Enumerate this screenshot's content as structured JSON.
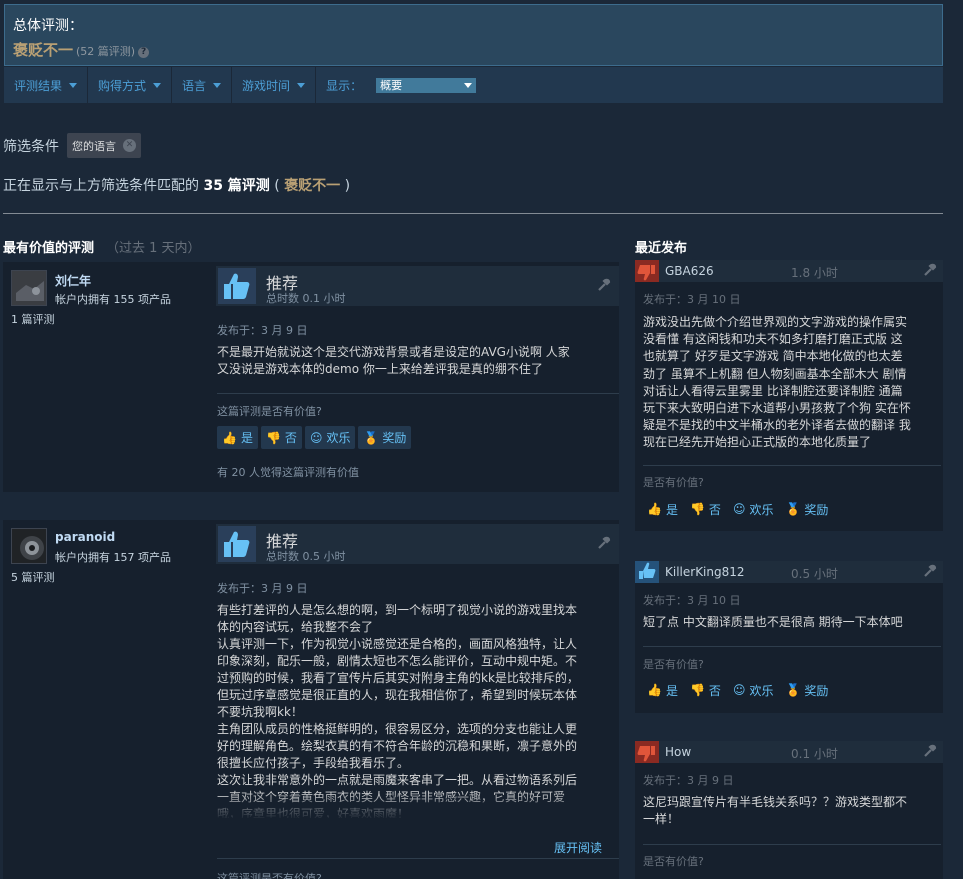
{
  "summary": {
    "label": "总体评测：",
    "rating": "褒贬不一",
    "count": "(52 篇评测)",
    "help_icon": "?"
  },
  "filterbar": {
    "items": [
      "评测结果",
      "购得方式",
      "语言",
      "游戏时间"
    ],
    "show_label": "显示：",
    "show_value": "概要"
  },
  "filters": {
    "label": "筛选条件",
    "chip": "您的语言",
    "chip_close": "✕"
  },
  "showing": {
    "prefix": "正在显示与上方筛选条件匹配的",
    "count": "35 篇评测",
    "paren_open": "(",
    "rating": "褒贬不一",
    "paren_close": ")"
  },
  "columns": {
    "helpful_title": "最有价值的评测",
    "helpful_sub": "（过去 1 天内）",
    "recent_title": "最近发布"
  },
  "colors": {
    "background": "#1b2838",
    "accent": "#66c0f4",
    "mixed": "#b9a074",
    "thumbs_up": "#67c1f5",
    "thumbs_down": "#a34c25"
  },
  "reviews": [
    {
      "author": "刘仁年",
      "products": "帐户内拥有 155 项产品",
      "reviews": "1 篇评测",
      "recommendation": "推荐",
      "hours": "总时数 0.1 小时",
      "posted": "发布于：3 月 9 日",
      "text": "不是最开始就说这个是交代游戏背景或者是设定的AVG小说啊 人家\n又没说是游戏本体的demo 你一上来给差评我是真的绷不住了",
      "helpful_q": "这篇评测是否有价值?",
      "yes": "是",
      "no": "否",
      "funny": "欢乐",
      "award": "奖励",
      "helpful_count": "有 20 人觉得这篇评测有价值"
    },
    {
      "author": "paranoid",
      "products": "帐户内拥有 157 项产品",
      "reviews": "5 篇评测",
      "recommendation": "推荐",
      "hours": "总时数 0.5 小时",
      "posted": "发布于：3 月 9 日",
      "text": "有些打差评的人是怎么想的啊，到一个标明了视觉小说的游戏里找本\n体的内容试玩，给我整不会了\n认真评测一下，作为视觉小说感觉还是合格的，画面风格独特，让人\n印象深刻，配乐一般，剧情太短也不怎么能评价，互动中规中矩。不\n过预购的时候，我看了宣传片后其实对附身主角的kk是比较排斥的，\n但玩过序章感觉是很正直的人，现在我相信你了，希望到时候玩本体\n不要坑我啊kk！\n主角团队成员的性格挺鲜明的，很容易区分，选项的分支也能让人更\n好的理解角色。绘梨衣真的有不符合年龄的沉稳和果断，凛子意外的\n很擅长应付孩子，手段给我看乐了。\n这次让我非常意外的一点就是雨魔来客串了一把。从看过物语系列后\n一直对这个穿着黄色雨衣的类人型怪异非常感兴趣，它真的好可爱\n哦，序章里也很可爱，好喜欢雨魔！",
      "read_more": "展开阅读",
      "helpful_q": "这篇评测是否有价值?"
    }
  ],
  "recent": [
    {
      "author": "GBA626",
      "hours": "1.8 小时",
      "type": "down",
      "posted": "发布于：3 月 10 日",
      "text": "游戏没出先做个介绍世界观的文字游戏的操作属实\n没看懂 有这闲钱和功夫不如多打磨打磨正式版 这\n也就算了 好歹是文字游戏 简中本地化做的也太差\n劲了 虽算不上机翻 但人物刻画基本全部木大 剧情\n对话让人看得云里雾里 比译制腔还要译制腔 通篇\n玩下来大致明白进下水道帮小男孩救了个狗 实在怀\n疑是不是找的中文半桶水的老外译者去做的翻译 我\n现在已经先开始担心正式版的本地化质量了",
      "helpful_q": "是否有价值?",
      "yes": "是",
      "no": "否",
      "funny": "欢乐",
      "award": "奖励"
    },
    {
      "author": "KillerKing812",
      "hours": "0.5 小时",
      "type": "up",
      "posted": "发布于：3 月 10 日",
      "text": "短了点 中文翻译质量也不是很高 期待一下本体吧",
      "helpful_q": "是否有价值?",
      "yes": "是",
      "no": "否",
      "funny": "欢乐",
      "award": "奖励"
    },
    {
      "author": "How",
      "hours": "0.1 小时",
      "type": "down",
      "posted": "发布于：3 月 9 日",
      "text": "这尼玛跟宣传片有半毛钱关系吗？？游戏类型都不\n一样！",
      "helpful_q": "是否有价值?"
    }
  ]
}
